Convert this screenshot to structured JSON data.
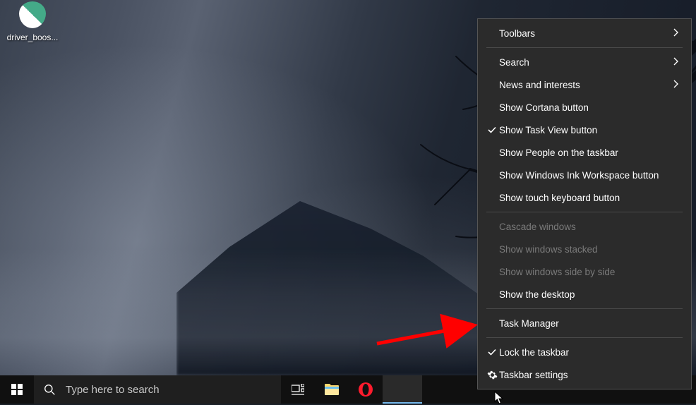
{
  "desktop": {
    "icon_label": "driver_boos..."
  },
  "taskbar": {
    "search_placeholder": "Type here to search"
  },
  "context_menu": {
    "items": [
      {
        "label": "Toolbars",
        "submenu": true,
        "checked": false,
        "disabled": false
      },
      {
        "sep": true
      },
      {
        "label": "Search",
        "submenu": true,
        "checked": false,
        "disabled": false
      },
      {
        "label": "News and interests",
        "submenu": true,
        "checked": false,
        "disabled": false
      },
      {
        "label": "Show Cortana button",
        "submenu": false,
        "checked": false,
        "disabled": false
      },
      {
        "label": "Show Task View button",
        "submenu": false,
        "checked": true,
        "disabled": false
      },
      {
        "label": "Show People on the taskbar",
        "submenu": false,
        "checked": false,
        "disabled": false
      },
      {
        "label": "Show Windows Ink Workspace button",
        "submenu": false,
        "checked": false,
        "disabled": false
      },
      {
        "label": "Show touch keyboard button",
        "submenu": false,
        "checked": false,
        "disabled": false
      },
      {
        "sep": true
      },
      {
        "label": "Cascade windows",
        "submenu": false,
        "checked": false,
        "disabled": true
      },
      {
        "label": "Show windows stacked",
        "submenu": false,
        "checked": false,
        "disabled": true
      },
      {
        "label": "Show windows side by side",
        "submenu": false,
        "checked": false,
        "disabled": true
      },
      {
        "label": "Show the desktop",
        "submenu": false,
        "checked": false,
        "disabled": false
      },
      {
        "sep": true
      },
      {
        "label": "Task Manager",
        "submenu": false,
        "checked": false,
        "disabled": false
      },
      {
        "sep": true
      },
      {
        "label": "Lock the taskbar",
        "submenu": false,
        "checked": true,
        "disabled": false
      },
      {
        "label": "Taskbar settings",
        "submenu": false,
        "checked": false,
        "disabled": false,
        "icon": "gear"
      }
    ]
  }
}
